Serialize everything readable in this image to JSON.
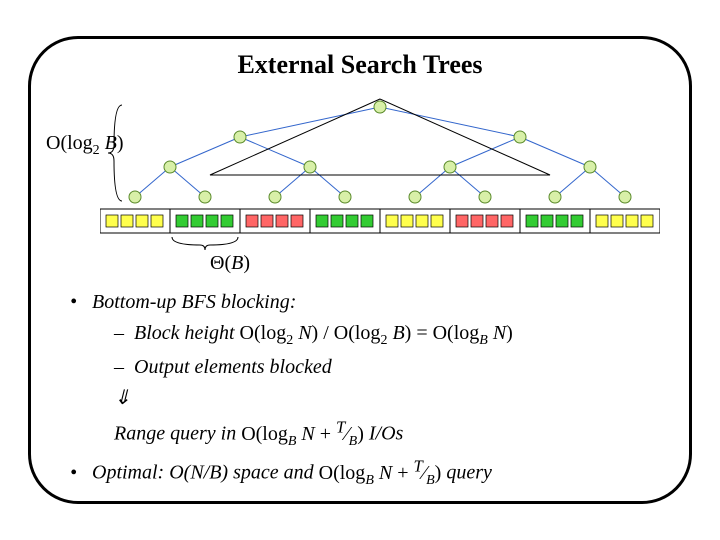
{
  "title": "External Search Trees",
  "labels": {
    "height": "O(log₂ B)",
    "theta": "Θ(B)"
  },
  "bullets": {
    "b1": "Bottom-up BFS blocking:",
    "s1_prefix": "Block height ",
    "s1_formula": "O(log₂ N) / O(log₂ B) = O(logB N)",
    "s2": "Output elements blocked",
    "arrow": "⇓",
    "b2_prefix": "Range query in ",
    "b2_suffix": " I/Os",
    "b3_prefix": "Optimal:",
    "b3_mid": "  O(N/B) space and ",
    "b3_suffix": " query"
  },
  "tree": {
    "levels": 4,
    "leaf_groups": 8,
    "group_colors": [
      "#ffff4d",
      "#33cc33",
      "#ff6666",
      "#33cc33",
      "#ffff4d",
      "#ff6666",
      "#33cc33",
      "#ffff4d"
    ]
  }
}
